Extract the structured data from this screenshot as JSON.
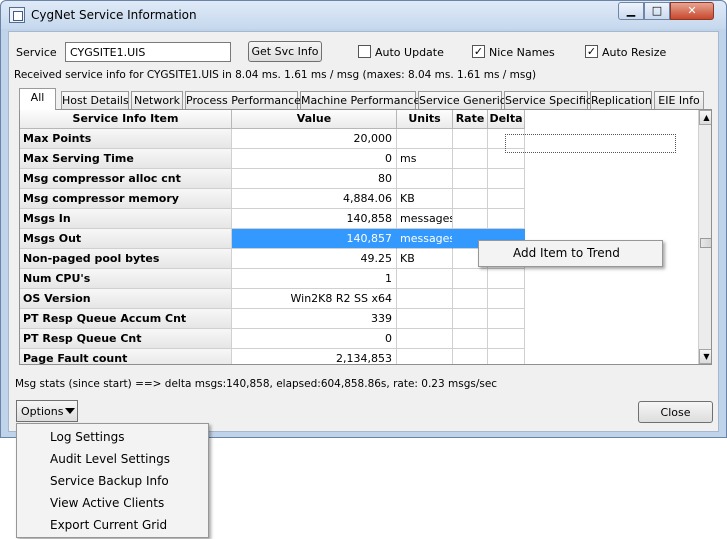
{
  "window": {
    "title": "CygNet Service Information",
    "min_icon": "minimize-icon",
    "max_icon": "maximize-icon",
    "close_icon": "close-icon"
  },
  "toolbar": {
    "service_label": "Service",
    "service_value": "CYGSITE1.UIS",
    "get_button": "Get Svc Info",
    "auto_update_label": "Auto Update",
    "auto_update_checked": false,
    "nice_names_label": "Nice Names",
    "nice_names_checked": true,
    "auto_resize_label": "Auto Resize",
    "auto_resize_checked": true
  },
  "status_text": "Received service info for CYGSITE1.UIS in 8.04 ms.  1.61 ms / msg (maxes: 8.04 ms.  1.61 ms / msg)",
  "tabs": [
    "All",
    "Host Details",
    "Network",
    "Process Performance",
    "Machine Performance",
    "Service Generic",
    "Service Specific",
    "Replication",
    "EIE Info"
  ],
  "active_tab": "All",
  "grid": {
    "headers": [
      "Service Info Item",
      "Value",
      "Units",
      "Rate",
      "Delta"
    ],
    "rows": [
      {
        "item": "Max Points",
        "value": "20,000",
        "units": ""
      },
      {
        "item": "Max Serving Time",
        "value": "0",
        "units": "ms"
      },
      {
        "item": "Msg compressor alloc cnt",
        "value": "80",
        "units": ""
      },
      {
        "item": "Msg compressor memory",
        "value": "4,884.06",
        "units": "KB"
      },
      {
        "item": "Msgs In",
        "value": "140,858",
        "units": "messages"
      },
      {
        "item": "Msgs Out",
        "value": "140,857",
        "units": "messages"
      },
      {
        "item": "Non-paged pool bytes",
        "value": "49.25",
        "units": "KB"
      },
      {
        "item": "Num CPU's",
        "value": "1",
        "units": ""
      },
      {
        "item": "OS Version",
        "value": "Win2K8 R2 SS x64",
        "units": ""
      },
      {
        "item": "PT Resp Queue Accum Cnt",
        "value": "339",
        "units": ""
      },
      {
        "item": "PT Resp Queue Cnt",
        "value": "0",
        "units": ""
      },
      {
        "item": "Page Fault count",
        "value": "2,134,853",
        "units": ""
      }
    ],
    "selected_row": "Msgs Out"
  },
  "context_menu": {
    "items": [
      "Add Item to Trend"
    ]
  },
  "msg_stats": "Msg stats (since start) ==> delta msgs:140,858, elapsed:604,858.86s, rate: 0.23 msgs/sec",
  "options_button": "Options",
  "close_button": "Close",
  "options_menu": {
    "items": [
      "Log Settings",
      "Audit Level Settings",
      "Service Backup Info",
      "View Active Clients",
      "Export Current Grid"
    ]
  }
}
